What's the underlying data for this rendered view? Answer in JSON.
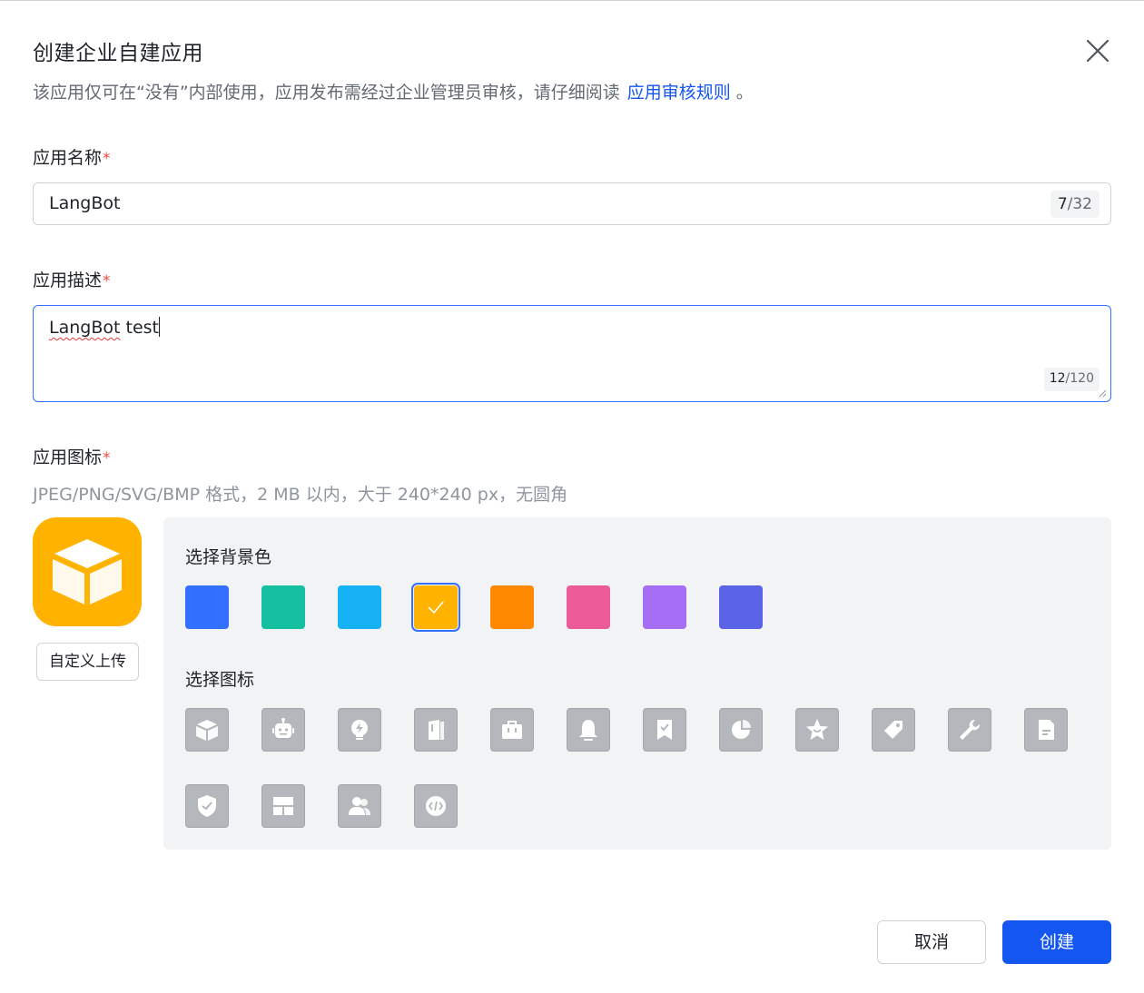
{
  "dialog": {
    "title": "创建企业自建应用",
    "subtitle": "该应用仅可在“没有”内部使用，应用发布需经过企业管理员审核，请仔细阅读",
    "rules_link": "应用审核规则",
    "subtitle_end": "。"
  },
  "form": {
    "required_mark": "*",
    "name": {
      "label": "应用名称",
      "value": "LangBot",
      "count": "7",
      "max": "/32"
    },
    "description": {
      "label": "应用描述",
      "value_word1": "LangBot",
      "value_rest": " test",
      "count": "12",
      "max": "/120"
    },
    "icon": {
      "label": "应用图标",
      "hint": "JPEG/PNG/SVG/BMP 格式，2 MB 以内，大于 240*240 px，无圆角",
      "upload_label": "自定义上传",
      "bg_label": "选择背景色",
      "icon_label": "选择图标",
      "selected_bg_index": 3,
      "selected_icon_index": 0,
      "bg_colors": [
        "#3370ff",
        "#14c0a0",
        "#17b1f5",
        "#ffb300",
        "#ff8800",
        "#eb5b97",
        "#a56ef5",
        "#5a62e6"
      ],
      "icons": [
        "cube-icon",
        "robot-icon",
        "lightbulb-icon",
        "book-icon",
        "briefcase-icon",
        "bell-icon",
        "bookmark-check-icon",
        "pie-chart-icon",
        "star-badge-icon",
        "tag-icon",
        "wrench-icon",
        "document-icon",
        "shield-check-icon",
        "layout-icon",
        "users-icon",
        "code-icon"
      ]
    }
  },
  "footer": {
    "cancel_label": "取消",
    "create_label": "创建"
  }
}
